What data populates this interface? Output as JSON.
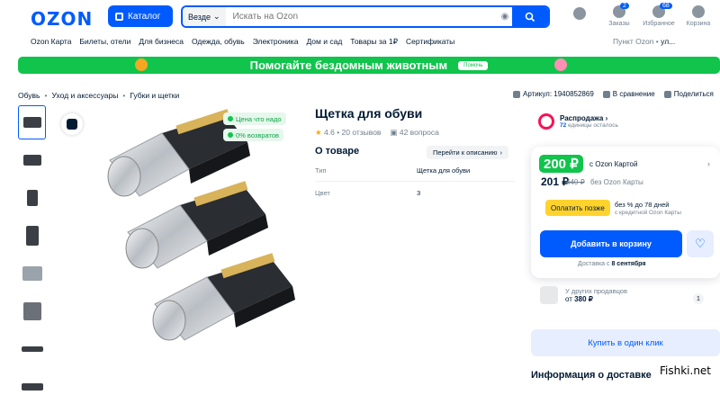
{
  "header": {
    "logo": "OZON",
    "catalog_label": "Каталог",
    "search_scope": "Везде",
    "search_placeholder": "Искать на Ozon",
    "icons": [
      {
        "label": "Заказы",
        "badge": "2"
      },
      {
        "label": "Избранное",
        "badge": "68"
      },
      {
        "label": "Корзина",
        "badge": ""
      }
    ]
  },
  "subnav": {
    "items": [
      "Ozon Карта",
      "Билеты, отели",
      "Для бизнеса",
      "Одежда, обувь",
      "Электроника",
      "Дом и сад",
      "Товары за 1₽",
      "Сертификаты"
    ],
    "pickup_label": "Пункт Ozon •",
    "pickup_value": "ул..."
  },
  "banner": {
    "text": "Помогайте бездомным животным",
    "button": "Помочь"
  },
  "breadcrumbs": [
    "Обувь",
    "Уход и аксессуары",
    "Губки и щетки"
  ],
  "product_actions": {
    "article": "Артикул: 1940852869",
    "compare": "В сравнение",
    "share": "Поделиться"
  },
  "gallery": {
    "tags": [
      "Цена что надо",
      "0% возвратов"
    ]
  },
  "product": {
    "title": "Щетка для обуви",
    "rating": "4.6",
    "reviews": "20 отзывов",
    "questions": "42 вопроса",
    "about_title": "О товаре",
    "to_description": "Перейти к описанию",
    "props": [
      {
        "name": "Тип",
        "value": "Щетка для обуви"
      },
      {
        "name": "Цвет",
        "value": "3"
      }
    ]
  },
  "sale": {
    "title": "Распродажа",
    "units": "72",
    "units_suffix": "единицы осталось"
  },
  "buybox": {
    "card_price": "200 ₽",
    "card_label": "с Ozon Картой",
    "price": "201 ₽",
    "old_price": "440 ₽",
    "without_card": "без Ozon Карты",
    "pay_later": "Оплатить позже",
    "pay_later_line1": "без % до 78 дней",
    "pay_later_line2": "с кредитной Ozon Карты",
    "add_to_cart": "Добавить в корзину",
    "delivery_prefix": "Доставка с",
    "delivery_date": "8 сентября"
  },
  "other_sellers": {
    "line1": "У других продавцов",
    "price_prefix": "от",
    "price": "380 ₽",
    "count": "1"
  },
  "one_click": "Купить в один клик",
  "delivery_info": "Информация о доставке",
  "watermark": "Fishki.net",
  "colors": {
    "brand": "#005bff",
    "green": "#10c44c",
    "yellow": "#ffd32c",
    "sale": "#f91155"
  }
}
